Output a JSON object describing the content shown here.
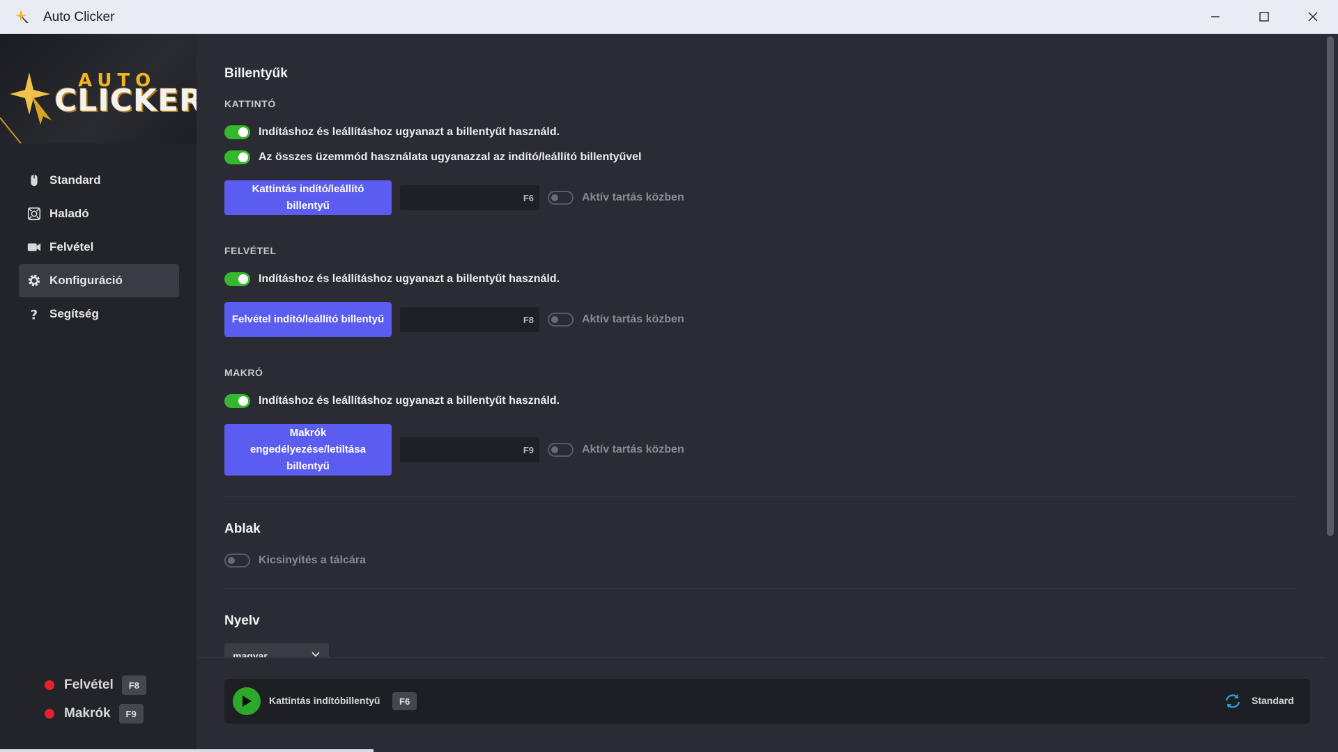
{
  "window": {
    "title": "Auto Clicker"
  },
  "logo": {
    "word1": "AUTO",
    "word2": "CLICKER"
  },
  "sidebar": {
    "items": [
      {
        "label": "Standard",
        "icon": "mouse-icon",
        "active": false
      },
      {
        "label": "Haladó",
        "icon": "advanced-icon",
        "active": false
      },
      {
        "label": "Felvétel",
        "icon": "video-camera-icon",
        "active": false
      },
      {
        "label": "Konfiguráció",
        "icon": "gear-icon",
        "active": true
      },
      {
        "label": "Segítség",
        "icon": "question-icon",
        "active": false
      }
    ],
    "status": [
      {
        "label": "Felvétel",
        "key": "F8",
        "color": "#e8202a"
      },
      {
        "label": "Makrók",
        "key": "F9",
        "color": "#e8202a"
      }
    ]
  },
  "main": {
    "hotkeys_title": "Billentyűk",
    "clicker": {
      "heading": "KATTINTÓ",
      "toggle1": "Indításhoz és leállításhoz ugyanazt a billentyűt használd.",
      "toggle2": "Az összes üzemmód használata ugyanazzal az indító/leállító billentyűvel",
      "button": "Kattintás indító/leállító billentyű",
      "key": "F6",
      "hold": "Aktív tartás közben"
    },
    "recording": {
      "heading": "FELVÉTEL",
      "toggle1": "Indításhoz és leállításhoz ugyanazt a billentyűt használd.",
      "button": "Felvétel indító/leállító billentyű",
      "key": "F8",
      "hold": "Aktív tartás közben"
    },
    "macro": {
      "heading": "MAKRÓ",
      "toggle1": "Indításhoz és leállításhoz ugyanazt a billentyűt használd.",
      "button": "Makrók engedélyezése/letiltása billentyű",
      "key": "F9",
      "hold": "Aktív tartás közben"
    },
    "window_title": "Ablak",
    "minimize_tray": "Kicsinyítés a tálcára",
    "language_title": "Nyelv",
    "language_value": "magyar"
  },
  "bottom": {
    "label": "Kattintás indítóbillentyű",
    "key": "F6",
    "mode": "Standard"
  },
  "colors": {
    "accent": "#5b5cf0",
    "toggle_on": "#35b82e",
    "record": "#e8202a"
  }
}
